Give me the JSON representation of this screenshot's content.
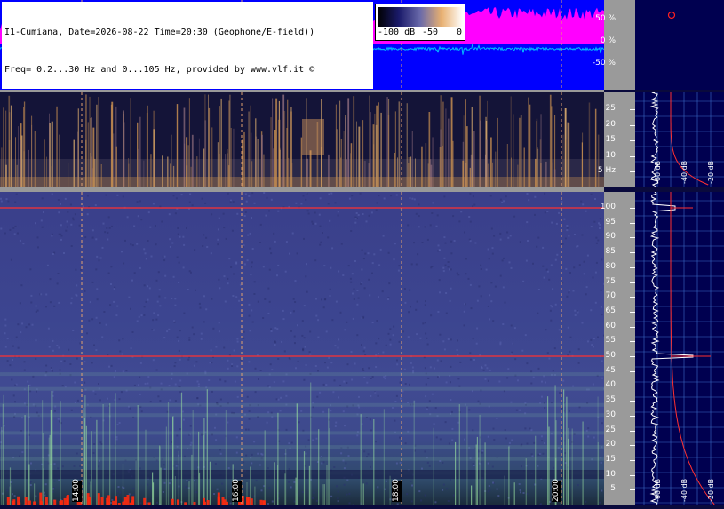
{
  "header": {
    "line1": "I1-Cumiana, Date=2026-08-22 Time=20:30 (Geophone/E-field))",
    "line2": "Freq= 0.2...30 Hz and 0...105 Hz, provided by www.vlf.it ©"
  },
  "scale": {
    "labels": [
      "-100 dB",
      "-50",
      "0"
    ]
  },
  "waveform_axis": {
    "ticks": [
      "50 %",
      "0 %",
      "-50 %"
    ]
  },
  "low_axis": {
    "ticks": [
      "25",
      "20",
      "15",
      "10",
      "5 Hz"
    ]
  },
  "high_axis": {
    "ticks": [
      "100",
      "95",
      "90",
      "85",
      "80",
      "75",
      "70",
      "65",
      "60",
      "55",
      "50",
      "45",
      "40",
      "35",
      "30",
      "25",
      "20",
      "15",
      "10",
      "5"
    ]
  },
  "time_labels": [
    "14:00",
    "16:00",
    "18:00",
    "20:00"
  ],
  "side_labels": {
    "low": [
      "-60 dB",
      "-40 dB",
      "-20 dB"
    ],
    "high": [
      "-60 dB",
      "-40 dB",
      "-20 dB"
    ]
  },
  "colors": {
    "waveform_bg": "#0000ff",
    "waveform_env": "#ff00ff",
    "trace": "#00c0ff",
    "marker": "#ff2020",
    "side_bg": "#000050"
  }
}
